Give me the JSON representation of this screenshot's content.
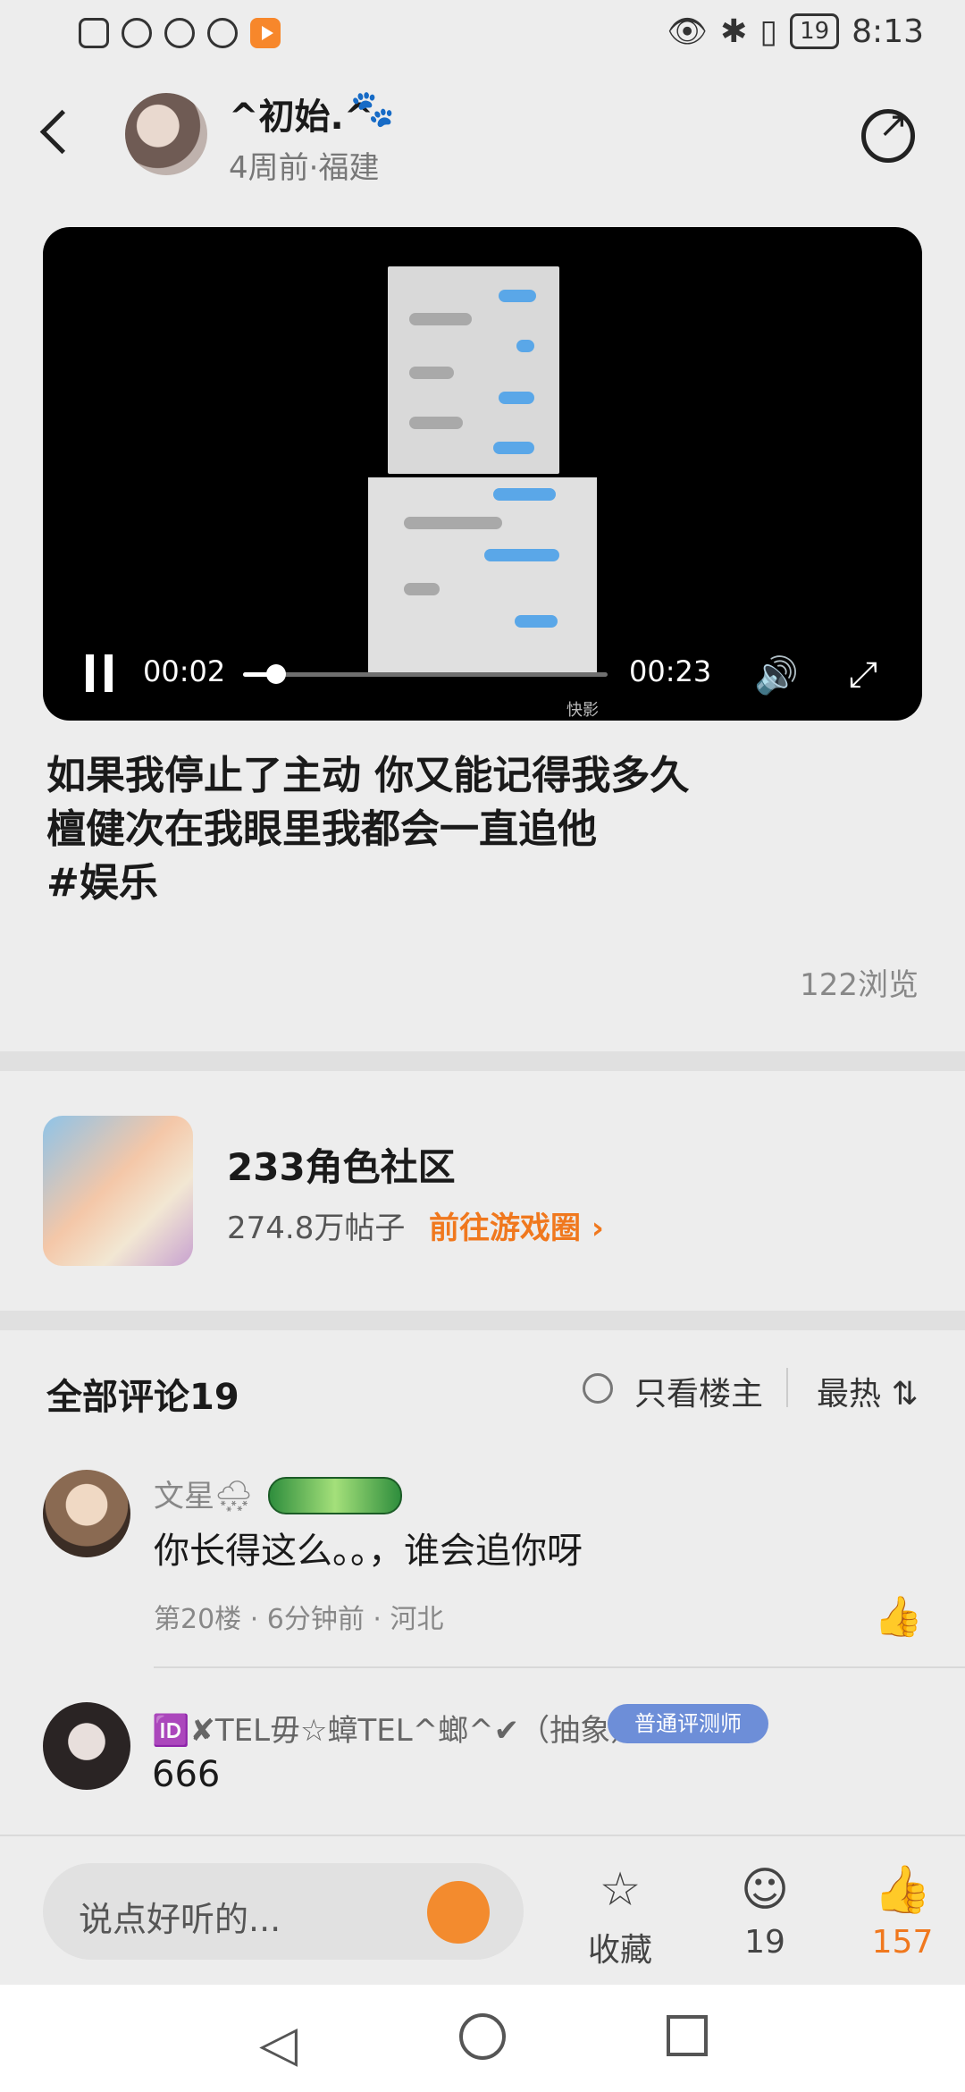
{
  "status_bar": {
    "time": "8:13",
    "battery": "19"
  },
  "header": {
    "username": "^初始.^",
    "paw_icon": "🐾",
    "meta": "4周前·福建"
  },
  "video": {
    "current_time": "00:02",
    "duration": "00:23",
    "progress": 0.09,
    "watermark": "快影"
  },
  "post": {
    "caption": "如果我停止了主动 你又能记得我多久\n檀健次在我眼里我都会一直追他\n#娱乐",
    "views": "122浏览"
  },
  "community": {
    "name": "233角色社区",
    "posts": "274.8万帖子",
    "link_label": "前往游戏圈 ›"
  },
  "comments": {
    "title": "全部评论19",
    "only_host_label": "只看楼主",
    "sort_label": "最热 ⇅",
    "items": [
      {
        "name": "文星🌨",
        "text": "你长得这么。。，谁会追你呀",
        "meta": "第20楼 · 6分钟前 · 河北"
      },
      {
        "name": "🆔✘TEL毋☆蟑TEL^螂^✔（抽象）",
        "badge": "普通评测师",
        "text": "666"
      }
    ]
  },
  "bottom_bar": {
    "input_placeholder": "说点好听的...",
    "favorite_label": "收藏",
    "comment_count": "19",
    "like_count": "157"
  },
  "colors": {
    "accent": "#f0781e",
    "badge_blue": "#6d8ed8"
  }
}
